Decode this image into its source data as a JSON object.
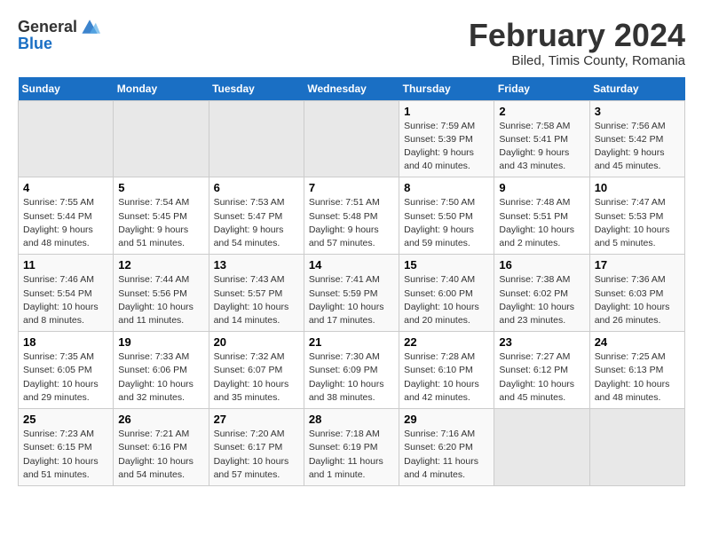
{
  "logo": {
    "general": "General",
    "blue": "Blue"
  },
  "title": "February 2024",
  "location": "Biled, Timis County, Romania",
  "days_of_week": [
    "Sunday",
    "Monday",
    "Tuesday",
    "Wednesday",
    "Thursday",
    "Friday",
    "Saturday"
  ],
  "weeks": [
    [
      {
        "day": "",
        "empty": true
      },
      {
        "day": "",
        "empty": true
      },
      {
        "day": "",
        "empty": true
      },
      {
        "day": "",
        "empty": true
      },
      {
        "day": "1",
        "sunrise": "7:59 AM",
        "sunset": "5:39 PM",
        "daylight": "9 hours and 40 minutes."
      },
      {
        "day": "2",
        "sunrise": "7:58 AM",
        "sunset": "5:41 PM",
        "daylight": "9 hours and 43 minutes."
      },
      {
        "day": "3",
        "sunrise": "7:56 AM",
        "sunset": "5:42 PM",
        "daylight": "9 hours and 45 minutes."
      }
    ],
    [
      {
        "day": "4",
        "sunrise": "7:55 AM",
        "sunset": "5:44 PM",
        "daylight": "9 hours and 48 minutes."
      },
      {
        "day": "5",
        "sunrise": "7:54 AM",
        "sunset": "5:45 PM",
        "daylight": "9 hours and 51 minutes."
      },
      {
        "day": "6",
        "sunrise": "7:53 AM",
        "sunset": "5:47 PM",
        "daylight": "9 hours and 54 minutes."
      },
      {
        "day": "7",
        "sunrise": "7:51 AM",
        "sunset": "5:48 PM",
        "daylight": "9 hours and 57 minutes."
      },
      {
        "day": "8",
        "sunrise": "7:50 AM",
        "sunset": "5:50 PM",
        "daylight": "9 hours and 59 minutes."
      },
      {
        "day": "9",
        "sunrise": "7:48 AM",
        "sunset": "5:51 PM",
        "daylight": "10 hours and 2 minutes."
      },
      {
        "day": "10",
        "sunrise": "7:47 AM",
        "sunset": "5:53 PM",
        "daylight": "10 hours and 5 minutes."
      }
    ],
    [
      {
        "day": "11",
        "sunrise": "7:46 AM",
        "sunset": "5:54 PM",
        "daylight": "10 hours and 8 minutes."
      },
      {
        "day": "12",
        "sunrise": "7:44 AM",
        "sunset": "5:56 PM",
        "daylight": "10 hours and 11 minutes."
      },
      {
        "day": "13",
        "sunrise": "7:43 AM",
        "sunset": "5:57 PM",
        "daylight": "10 hours and 14 minutes."
      },
      {
        "day": "14",
        "sunrise": "7:41 AM",
        "sunset": "5:59 PM",
        "daylight": "10 hours and 17 minutes."
      },
      {
        "day": "15",
        "sunrise": "7:40 AM",
        "sunset": "6:00 PM",
        "daylight": "10 hours and 20 minutes."
      },
      {
        "day": "16",
        "sunrise": "7:38 AM",
        "sunset": "6:02 PM",
        "daylight": "10 hours and 23 minutes."
      },
      {
        "day": "17",
        "sunrise": "7:36 AM",
        "sunset": "6:03 PM",
        "daylight": "10 hours and 26 minutes."
      }
    ],
    [
      {
        "day": "18",
        "sunrise": "7:35 AM",
        "sunset": "6:05 PM",
        "daylight": "10 hours and 29 minutes."
      },
      {
        "day": "19",
        "sunrise": "7:33 AM",
        "sunset": "6:06 PM",
        "daylight": "10 hours and 32 minutes."
      },
      {
        "day": "20",
        "sunrise": "7:32 AM",
        "sunset": "6:07 PM",
        "daylight": "10 hours and 35 minutes."
      },
      {
        "day": "21",
        "sunrise": "7:30 AM",
        "sunset": "6:09 PM",
        "daylight": "10 hours and 38 minutes."
      },
      {
        "day": "22",
        "sunrise": "7:28 AM",
        "sunset": "6:10 PM",
        "daylight": "10 hours and 42 minutes."
      },
      {
        "day": "23",
        "sunrise": "7:27 AM",
        "sunset": "6:12 PM",
        "daylight": "10 hours and 45 minutes."
      },
      {
        "day": "24",
        "sunrise": "7:25 AM",
        "sunset": "6:13 PM",
        "daylight": "10 hours and 48 minutes."
      }
    ],
    [
      {
        "day": "25",
        "sunrise": "7:23 AM",
        "sunset": "6:15 PM",
        "daylight": "10 hours and 51 minutes."
      },
      {
        "day": "26",
        "sunrise": "7:21 AM",
        "sunset": "6:16 PM",
        "daylight": "10 hours and 54 minutes."
      },
      {
        "day": "27",
        "sunrise": "7:20 AM",
        "sunset": "6:17 PM",
        "daylight": "10 hours and 57 minutes."
      },
      {
        "day": "28",
        "sunrise": "7:18 AM",
        "sunset": "6:19 PM",
        "daylight": "11 hours and 1 minute."
      },
      {
        "day": "29",
        "sunrise": "7:16 AM",
        "sunset": "6:20 PM",
        "daylight": "11 hours and 4 minutes."
      },
      {
        "day": "",
        "empty": true
      },
      {
        "day": "",
        "empty": true
      }
    ]
  ],
  "labels": {
    "sunrise": "Sunrise:",
    "sunset": "Sunset:",
    "daylight": "Daylight:"
  }
}
